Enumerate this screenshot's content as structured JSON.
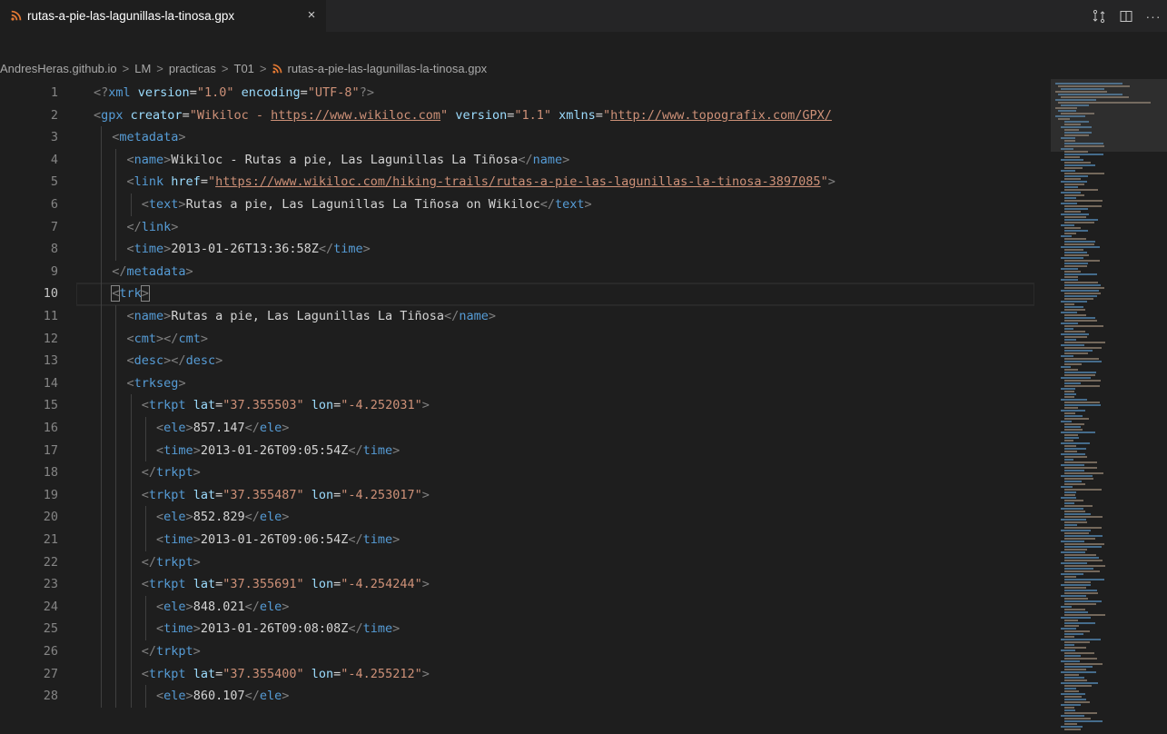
{
  "tab": {
    "label": "rutas-a-pie-las-lagunillas-la-tinosa.gpx",
    "close": "×"
  },
  "actions": {
    "source_control_glyph": "⇅",
    "split_glyph": "◫",
    "more_glyph": "···"
  },
  "breadcrumb": {
    "items": [
      "AndresHeras.github.io",
      "LM",
      "practicas",
      "T01",
      "rutas-a-pie-las-lagunillas-la-tinosa.gpx"
    ],
    "separator": ">"
  },
  "editor": {
    "current_line": 10,
    "lines": [
      {
        "n": "1",
        "indent": 0,
        "tokens": [
          [
            "p",
            "<?"
          ],
          [
            "t",
            "xml "
          ],
          [
            "a",
            "version"
          ],
          [
            "x",
            "="
          ],
          [
            "s",
            "\"1.0\""
          ],
          [
            "x",
            " "
          ],
          [
            "a",
            "encoding"
          ],
          [
            "x",
            "="
          ],
          [
            "s",
            "\"UTF-8\""
          ],
          [
            "p",
            "?>"
          ]
        ]
      },
      {
        "n": "2",
        "indent": 0,
        "tokens": [
          [
            "p",
            "<"
          ],
          [
            "t",
            "gpx "
          ],
          [
            "a",
            "creator"
          ],
          [
            "x",
            "="
          ],
          [
            "s",
            "\"Wikiloc - "
          ],
          [
            "u",
            "https://www.wikiloc.com"
          ],
          [
            "s",
            "\""
          ],
          [
            "x",
            " "
          ],
          [
            "a",
            "version"
          ],
          [
            "x",
            "="
          ],
          [
            "s",
            "\"1.1\""
          ],
          [
            "x",
            " "
          ],
          [
            "a",
            "xmlns"
          ],
          [
            "x",
            "="
          ],
          [
            "s",
            "\""
          ],
          [
            "u",
            "http://www.topografix.com/GPX/"
          ]
        ]
      },
      {
        "n": "3",
        "indent": 1,
        "tokens": [
          [
            "p",
            "<"
          ],
          [
            "t",
            "metadata"
          ],
          [
            "p",
            ">"
          ]
        ]
      },
      {
        "n": "4",
        "indent": 2,
        "tokens": [
          [
            "p",
            "<"
          ],
          [
            "t",
            "name"
          ],
          [
            "p",
            ">"
          ],
          [
            "x",
            "Wikiloc - Rutas a pie, Las Lagunillas La Tiñosa"
          ],
          [
            "p",
            "</"
          ],
          [
            "t",
            "name"
          ],
          [
            "p",
            ">"
          ]
        ]
      },
      {
        "n": "5",
        "indent": 2,
        "tokens": [
          [
            "p",
            "<"
          ],
          [
            "t",
            "link "
          ],
          [
            "a",
            "href"
          ],
          [
            "x",
            "="
          ],
          [
            "s",
            "\""
          ],
          [
            "u",
            "https://www.wikiloc.com/hiking-trails/rutas-a-pie-las-lagunillas-la-tinosa-3897085"
          ],
          [
            "s",
            "\""
          ],
          [
            "p",
            ">"
          ]
        ]
      },
      {
        "n": "6",
        "indent": 3,
        "tokens": [
          [
            "p",
            "<"
          ],
          [
            "t",
            "text"
          ],
          [
            "p",
            ">"
          ],
          [
            "x",
            "Rutas a pie, Las Lagunillas La Tiñosa on Wikiloc"
          ],
          [
            "p",
            "</"
          ],
          [
            "t",
            "text"
          ],
          [
            "p",
            ">"
          ]
        ]
      },
      {
        "n": "7",
        "indent": 2,
        "tokens": [
          [
            "p",
            "</"
          ],
          [
            "t",
            "link"
          ],
          [
            "p",
            ">"
          ]
        ]
      },
      {
        "n": "8",
        "indent": 2,
        "tokens": [
          [
            "p",
            "<"
          ],
          [
            "t",
            "time"
          ],
          [
            "p",
            ">"
          ],
          [
            "x",
            "2013-01-26T13:36:58Z"
          ],
          [
            "p",
            "</"
          ],
          [
            "t",
            "time"
          ],
          [
            "p",
            ">"
          ]
        ]
      },
      {
        "n": "9",
        "indent": 1,
        "tokens": [
          [
            "p",
            "</"
          ],
          [
            "t",
            "metadata"
          ],
          [
            "p",
            ">"
          ]
        ]
      },
      {
        "n": "10",
        "indent": 1,
        "tokens": [
          [
            "p",
            "<"
          ],
          [
            "t",
            "trk"
          ],
          [
            "p",
            ">"
          ]
        ]
      },
      {
        "n": "11",
        "indent": 2,
        "tokens": [
          [
            "p",
            "<"
          ],
          [
            "t",
            "name"
          ],
          [
            "p",
            ">"
          ],
          [
            "x",
            "Rutas a pie, Las Lagunillas La Tiñosa"
          ],
          [
            "p",
            "</"
          ],
          [
            "t",
            "name"
          ],
          [
            "p",
            ">"
          ]
        ]
      },
      {
        "n": "12",
        "indent": 2,
        "tokens": [
          [
            "p",
            "<"
          ],
          [
            "t",
            "cmt"
          ],
          [
            "p",
            "></"
          ],
          [
            "t",
            "cmt"
          ],
          [
            "p",
            ">"
          ]
        ]
      },
      {
        "n": "13",
        "indent": 2,
        "tokens": [
          [
            "p",
            "<"
          ],
          [
            "t",
            "desc"
          ],
          [
            "p",
            "></"
          ],
          [
            "t",
            "desc"
          ],
          [
            "p",
            ">"
          ]
        ]
      },
      {
        "n": "14",
        "indent": 2,
        "tokens": [
          [
            "p",
            "<"
          ],
          [
            "t",
            "trkseg"
          ],
          [
            "p",
            ">"
          ]
        ]
      },
      {
        "n": "15",
        "indent": 3,
        "tokens": [
          [
            "p",
            "<"
          ],
          [
            "t",
            "trkpt "
          ],
          [
            "a",
            "lat"
          ],
          [
            "x",
            "="
          ],
          [
            "s",
            "\"37.355503\""
          ],
          [
            "x",
            " "
          ],
          [
            "a",
            "lon"
          ],
          [
            "x",
            "="
          ],
          [
            "s",
            "\"-4.252031\""
          ],
          [
            "p",
            ">"
          ]
        ]
      },
      {
        "n": "16",
        "indent": 4,
        "tokens": [
          [
            "p",
            "<"
          ],
          [
            "t",
            "ele"
          ],
          [
            "p",
            ">"
          ],
          [
            "x",
            "857.147"
          ],
          [
            "p",
            "</"
          ],
          [
            "t",
            "ele"
          ],
          [
            "p",
            ">"
          ]
        ]
      },
      {
        "n": "17",
        "indent": 4,
        "tokens": [
          [
            "p",
            "<"
          ],
          [
            "t",
            "time"
          ],
          [
            "p",
            ">"
          ],
          [
            "x",
            "2013-01-26T09:05:54Z"
          ],
          [
            "p",
            "</"
          ],
          [
            "t",
            "time"
          ],
          [
            "p",
            ">"
          ]
        ]
      },
      {
        "n": "18",
        "indent": 3,
        "tokens": [
          [
            "p",
            "</"
          ],
          [
            "t",
            "trkpt"
          ],
          [
            "p",
            ">"
          ]
        ]
      },
      {
        "n": "19",
        "indent": 3,
        "tokens": [
          [
            "p",
            "<"
          ],
          [
            "t",
            "trkpt "
          ],
          [
            "a",
            "lat"
          ],
          [
            "x",
            "="
          ],
          [
            "s",
            "\"37.355487\""
          ],
          [
            "x",
            " "
          ],
          [
            "a",
            "lon"
          ],
          [
            "x",
            "="
          ],
          [
            "s",
            "\"-4.253017\""
          ],
          [
            "p",
            ">"
          ]
        ]
      },
      {
        "n": "20",
        "indent": 4,
        "tokens": [
          [
            "p",
            "<"
          ],
          [
            "t",
            "ele"
          ],
          [
            "p",
            ">"
          ],
          [
            "x",
            "852.829"
          ],
          [
            "p",
            "</"
          ],
          [
            "t",
            "ele"
          ],
          [
            "p",
            ">"
          ]
        ]
      },
      {
        "n": "21",
        "indent": 4,
        "tokens": [
          [
            "p",
            "<"
          ],
          [
            "t",
            "time"
          ],
          [
            "p",
            ">"
          ],
          [
            "x",
            "2013-01-26T09:06:54Z"
          ],
          [
            "p",
            "</"
          ],
          [
            "t",
            "time"
          ],
          [
            "p",
            ">"
          ]
        ]
      },
      {
        "n": "22",
        "indent": 3,
        "tokens": [
          [
            "p",
            "</"
          ],
          [
            "t",
            "trkpt"
          ],
          [
            "p",
            ">"
          ]
        ]
      },
      {
        "n": "23",
        "indent": 3,
        "tokens": [
          [
            "p",
            "<"
          ],
          [
            "t",
            "trkpt "
          ],
          [
            "a",
            "lat"
          ],
          [
            "x",
            "="
          ],
          [
            "s",
            "\"37.355691\""
          ],
          [
            "x",
            " "
          ],
          [
            "a",
            "lon"
          ],
          [
            "x",
            "="
          ],
          [
            "s",
            "\"-4.254244\""
          ],
          [
            "p",
            ">"
          ]
        ]
      },
      {
        "n": "24",
        "indent": 4,
        "tokens": [
          [
            "p",
            "<"
          ],
          [
            "t",
            "ele"
          ],
          [
            "p",
            ">"
          ],
          [
            "x",
            "848.021"
          ],
          [
            "p",
            "</"
          ],
          [
            "t",
            "ele"
          ],
          [
            "p",
            ">"
          ]
        ]
      },
      {
        "n": "25",
        "indent": 4,
        "tokens": [
          [
            "p",
            "<"
          ],
          [
            "t",
            "time"
          ],
          [
            "p",
            ">"
          ],
          [
            "x",
            "2013-01-26T09:08:08Z"
          ],
          [
            "p",
            "</"
          ],
          [
            "t",
            "time"
          ],
          [
            "p",
            ">"
          ]
        ]
      },
      {
        "n": "26",
        "indent": 3,
        "tokens": [
          [
            "p",
            "</"
          ],
          [
            "t",
            "trkpt"
          ],
          [
            "p",
            ">"
          ]
        ]
      },
      {
        "n": "27",
        "indent": 3,
        "tokens": [
          [
            "p",
            "<"
          ],
          [
            "t",
            "trkpt "
          ],
          [
            "a",
            "lat"
          ],
          [
            "x",
            "="
          ],
          [
            "s",
            "\"37.355400\""
          ],
          [
            "x",
            " "
          ],
          [
            "a",
            "lon"
          ],
          [
            "x",
            "="
          ],
          [
            "s",
            "\"-4.255212\""
          ],
          [
            "p",
            ">"
          ]
        ]
      },
      {
        "n": "28",
        "indent": 4,
        "tokens": [
          [
            "p",
            "<"
          ],
          [
            "t",
            "ele"
          ],
          [
            "p",
            ">"
          ],
          [
            "x",
            "860.107"
          ],
          [
            "p",
            "</"
          ],
          [
            "t",
            "ele"
          ],
          [
            "p",
            ">"
          ]
        ]
      }
    ]
  },
  "colors": {
    "tag": "#569cd6",
    "attr": "#9cdcfe",
    "string": "#ce9178",
    "punct": "#808080",
    "text": "#d4d4d4",
    "rss_icon": "#e37933"
  }
}
